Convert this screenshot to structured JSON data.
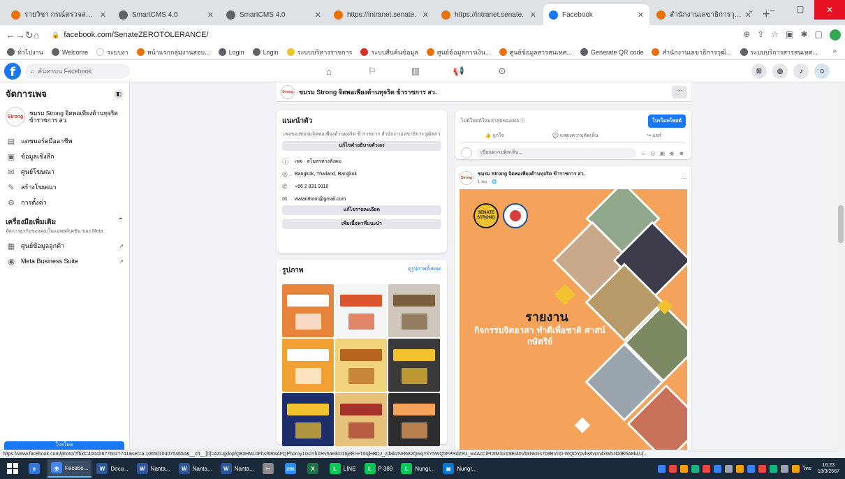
{
  "browser": {
    "tabs": [
      {
        "title": "รายวิชา กรณ์ตรวจสอบภายใน",
        "color": "#e8710a",
        "active": false
      },
      {
        "title": "SmartCMS 4.0",
        "color": "#5f6368",
        "active": false
      },
      {
        "title": "SmartCMS 4.0",
        "color": "#5f6368",
        "active": false
      },
      {
        "title": "https://intranet.senate.",
        "color": "#e8710a",
        "active": false
      },
      {
        "title": "https://intranet.senate.",
        "color": "#e8710a",
        "active": false
      },
      {
        "title": "Facebook",
        "color": "#1877f2",
        "active": true
      },
      {
        "title": "สำนักงานเลขาธิการวุฒิสภา",
        "color": "#e8710a",
        "active": false
      }
    ],
    "new_tab": "+",
    "window_controls": {
      "minimize": "–",
      "maximize": "☐",
      "close": "✕"
    },
    "url": "facebook.com/SenateZEROTOLERANCE/",
    "bookmarks": [
      {
        "label": "ทั่วไปงาน",
        "color": "#5f6368"
      },
      {
        "label": "Welcome",
        "color": "#5f6368"
      },
      {
        "label": "ระบบงา",
        "color": "#ffffff"
      },
      {
        "label": "หน้าแรกกลุ่มงานสอบ...",
        "color": "#e8710a"
      },
      {
        "label": "Login",
        "color": "#5f6368"
      },
      {
        "label": "Login",
        "color": "#5f6368"
      },
      {
        "label": "ระบบบริหารราชการ",
        "color": "#f2c12e"
      },
      {
        "label": "ระบบสืบค้นข้อมูล",
        "color": "#d93025"
      },
      {
        "label": "ศูนย์ข้อมูลการเงิน...",
        "color": "#e8710a"
      },
      {
        "label": "ศูนย์ข้อมูลสารสนเทศ...",
        "color": "#e8710a"
      },
      {
        "label": "Generate QR code",
        "color": "#5f6368"
      },
      {
        "label": "สำนักงานเลขาธิการวุฒิ...",
        "color": "#e8710a"
      },
      {
        "label": "ระบบบริการสารสนเทศ...",
        "color": "#5f6368"
      }
    ],
    "bookmarks_more": "»"
  },
  "facebook": {
    "search_placeholder": "ค้นหาบน Facebook",
    "center_nav": [
      "home-icon",
      "pages-icon",
      "marketplace-icon",
      "ads-icon",
      "notifications-icon"
    ],
    "right_nav": [
      "menu-icon",
      "messenger-icon",
      "bell-icon",
      "profile-avatar"
    ]
  },
  "sidebar": {
    "title": "จัดการเพจ",
    "page_avatar_text": "Strong",
    "page_name": "ชมรม Strong จิตพอเพียงต้านทุจริต ข้าราชการ สว.",
    "items": [
      {
        "icon": "▤",
        "label": "แดชบอร์ดมืออาชีพ"
      },
      {
        "icon": "▣",
        "label": "ข้อมูลเชิงลึก"
      },
      {
        "icon": "✉",
        "label": "ศูนย์โฆษณา"
      },
      {
        "icon": "✎",
        "label": "สร้างโฆษณา"
      },
      {
        "icon": "⚙",
        "label": "การตั้งค่า"
      }
    ],
    "tools_title": "เครื่องมือเพิ่มเติม",
    "tools_sub": "จัดการธุรกิจของคุณในแอพพลิเคชัน ของ Meta",
    "tools": [
      {
        "icon": "▦",
        "label": "ศูนย์ข้อมูลลูกค้า",
        "tail": "↗"
      },
      {
        "icon": "◉",
        "label": "Meta Business Suite",
        "tail": "↗"
      }
    ],
    "promote": "โปรโมท"
  },
  "pagebar": {
    "name": "ชมรม Strong จิตพอเพียงต้านทุจริต ข้าราชการ สว.",
    "more": "···"
  },
  "intro": {
    "title": "แนะนำตัว",
    "desc": "เพจของชมรมจิตพอเพียงต้านทุจริต ข้าราชการ สำนักงานเลขาธิการวุฒิสภา",
    "edit_bio_button": "แก้ไขคำอธิบายตัวเอง",
    "info": [
      {
        "icon": "ⓘ",
        "text": "เพจ · สโมสรทางสังคม"
      },
      {
        "icon": "◎",
        "text": "Bangkok, Thailand, Bangkok"
      },
      {
        "icon": "✆",
        "text": "+66 2 831 9110"
      },
      {
        "icon": "✉",
        "text": "watanthom@gmail.com"
      }
    ],
    "edit_details_button": "แก้ไขรายละเอียด",
    "add_featured_button": "เพิ่มเนื้อหาที่แนะนำ"
  },
  "photos": {
    "title": "รูปภาพ",
    "see_all": "ดูรูปภาพทั้งหมด",
    "tiles": [
      {
        "bg": "#e7833a",
        "accent": "#ffffff"
      },
      {
        "bg": "#f4f4f4",
        "accent": "#d9562c"
      },
      {
        "bg": "#cfc7bc",
        "accent": "#7a5f3c"
      },
      {
        "bg": "#f1a133",
        "accent": "#ffffff"
      },
      {
        "bg": "#f1d47a",
        "accent": "#b5651d"
      },
      {
        "bg": "#3a3a3a",
        "accent": "#f2c12e"
      },
      {
        "bg": "#1c2f6a",
        "accent": "#f2c12e"
      },
      {
        "bg": "#e6c27a",
        "accent": "#a3322b"
      },
      {
        "bg": "#2d2d2d",
        "accent": "#f5a25a"
      }
    ]
  },
  "composer": {
    "prompt": "ไม่มีโพสต์ใหม่ล่าสุดของเพจ",
    "info_icon": "ⓘ",
    "post_button": "โปรโมทโพสต์",
    "actions": [
      "👍 ถูกใจ",
      "💬 แสดงความคิดเห็น",
      "↪ แชร์"
    ],
    "comment_placeholder": "เขียนความคิดเห็น...",
    "emoji_row": "☺ ◎ ▣ ◉ ☻"
  },
  "post": {
    "page_name": "ชมรม Strong จิตพอเพียงต้านทุจริต ข้าราชการ สว.",
    "time": "1 ชม. · 🌐",
    "more": "···",
    "badge_text": "SENATE STRONG",
    "poster_title": "รายงาน",
    "poster_subtitle": "กิจกรรมจิตอาสา ทำดีเพื่อชาติ ศาสน์ กษัตริย์"
  },
  "status_url": "https://www.facebook.com/photo/?fbid=400426776027741&set=a.106501040753650&__cft__[0]=AZUgdopfQ83HMLbFhsf6R8AFQPhoroy1GoYhXRv54eiK016jeEl-eTdnjHBDJ_zdab2NH682QwqYkY5WQ5FPRdZRz_w4AcCiPt2tMXvX9EI40VbkNkGs7b9BVnD-WQOYpvfezlvrm4xWhJDdB5A8k4Uj...",
  "taskbar": {
    "items": [
      {
        "label": "",
        "color": "#3277d8",
        "icon": "e",
        "active": false
      },
      {
        "label": "Facebo...",
        "color": "#4285f4",
        "icon": "◉",
        "active": true
      },
      {
        "label": "Docu...",
        "color": "#2b579a",
        "icon": "W",
        "active": false
      },
      {
        "label": "Nanta...",
        "color": "#2b579a",
        "icon": "W",
        "active": false
      },
      {
        "label": "Nanta...",
        "color": "#2b579a",
        "icon": "W",
        "active": false
      },
      {
        "label": "Nanta...",
        "color": "#2b579a",
        "icon": "W",
        "active": false
      },
      {
        "label": "",
        "color": "#8a8a8a",
        "icon": "✂",
        "active": false
      },
      {
        "label": "",
        "color": "#2d8cff",
        "icon": "zm",
        "active": false
      },
      {
        "label": "",
        "color": "#217346",
        "icon": "X",
        "active": false
      },
      {
        "label": "LINE",
        "color": "#06c755",
        "icon": "L",
        "active": false
      },
      {
        "label": "P 389",
        "color": "#06c755",
        "icon": "L",
        "active": false
      },
      {
        "label": "Nungr...",
        "color": "#06c755",
        "icon": "L",
        "active": false
      },
      {
        "label": "Nungr...",
        "color": "#0078d4",
        "icon": "▣",
        "active": false
      }
    ],
    "tray_colors": [
      "#3b82f6",
      "#ef4444",
      "#f59e0b",
      "#10b981",
      "#ef4444",
      "#3b82f6",
      "#9ca3af",
      "#f59e0b",
      "#3b82f6",
      "#ef4444",
      "#10b981",
      "#9ca3af",
      "#f59e0b"
    ],
    "lang": "ไทย",
    "time": "16:23",
    "date": "18/3/2567"
  }
}
